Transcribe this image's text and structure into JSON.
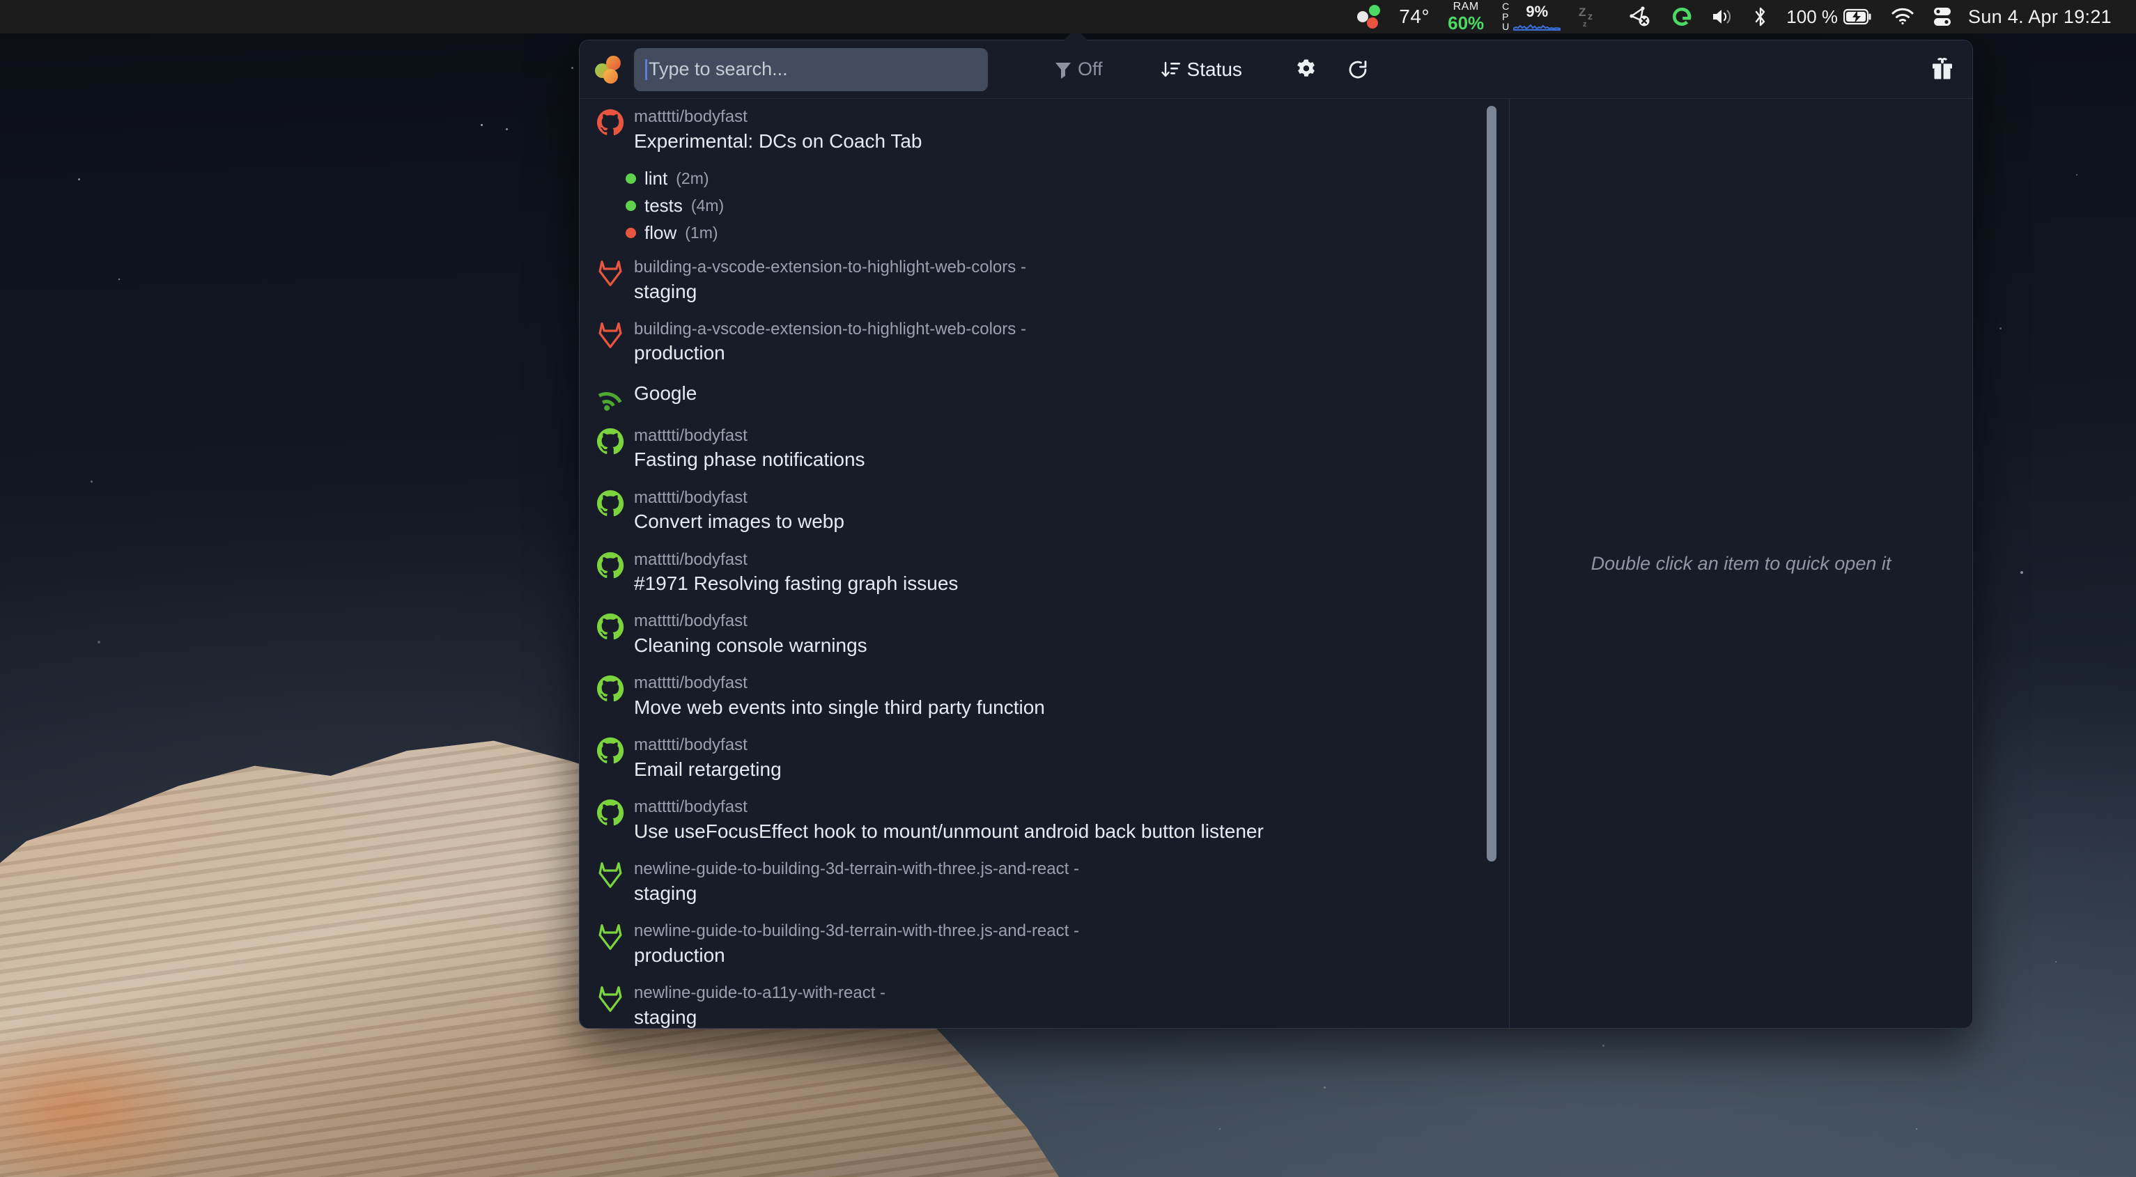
{
  "menubar": {
    "app_dots_icon": "three-dots-icon",
    "temperature": "74°",
    "ram_label": "RAM",
    "ram_value": "60%",
    "cpu_label": "CPU",
    "cpu_value": "9%",
    "caffeine_icon": "zzz-icon",
    "airplay_muted_icon": "airplay-muted-icon",
    "grammarly_icon": "grammarly-g-icon",
    "volume_icon": "volume-icon",
    "bluetooth_icon": "bluetooth-icon",
    "battery_percent": "100 %",
    "battery_icon": "battery-charging-icon",
    "wifi_icon": "wifi-icon",
    "control_center_icon": "control-center-icon",
    "datetime": "Sun 4. Apr  19:21",
    "colors": {
      "green": "#4cd964",
      "red": "#e8543f",
      "white": "#e8e8e8",
      "cpu_graph": "#3a6fd8"
    }
  },
  "window": {
    "logo_icon": "three-circles-logo",
    "search": {
      "value": "",
      "placeholder": "Type to search..."
    },
    "toolbar": {
      "filter_icon": "filter-icon",
      "filter_label": "Off",
      "sort_icon": "sort-descending-icon",
      "sort_label": "Status",
      "settings_icon": "gear-icon",
      "refresh_icon": "refresh-icon",
      "gift_icon": "gift-icon"
    },
    "right_panel": {
      "hint": "Double click an item to quick open it"
    },
    "colors": {
      "window_bg": "#171c28",
      "search_bg": "#434b5e",
      "github_green": "#7bd43e",
      "github_red": "#e8563f",
      "gitlab_red": "#e8563f",
      "gitlab_green": "#7bd43e",
      "rss_green": "#4fa832",
      "scrollbar": "#7c8596"
    },
    "items": [
      {
        "source": "github",
        "icon": "github-icon",
        "icon_color": "#e8563f",
        "repo": "matttti/bodyfast",
        "title": "Experimental: DCs on Coach Tab",
        "checks": [
          {
            "name": "lint",
            "duration": "(2m)",
            "status_color": "#5ed24b"
          },
          {
            "name": "tests",
            "duration": "(4m)",
            "status_color": "#5ed24b"
          },
          {
            "name": "flow",
            "duration": "(1m)",
            "status_color": "#e8563f"
          }
        ]
      },
      {
        "source": "gitlab",
        "icon": "gitlab-icon",
        "icon_color": "#e8563f",
        "repo": "building-a-vscode-extension-to-highlight-web-colors",
        "sep": "-",
        "title": "staging",
        "checks": []
      },
      {
        "source": "gitlab",
        "icon": "gitlab-icon",
        "icon_color": "#e8563f",
        "repo": "building-a-vscode-extension-to-highlight-web-colors",
        "sep": "-",
        "title": "production",
        "checks": []
      },
      {
        "source": "rss",
        "icon": "rss-icon",
        "icon_color": "#4fa832",
        "repo": "",
        "title": "Google",
        "checks": []
      },
      {
        "source": "github",
        "icon": "github-icon",
        "icon_color": "#7bd43e",
        "repo": "matttti/bodyfast",
        "title": "Fasting phase notifications",
        "checks": []
      },
      {
        "source": "github",
        "icon": "github-icon",
        "icon_color": "#7bd43e",
        "repo": "matttti/bodyfast",
        "title": "Convert images to webp",
        "checks": []
      },
      {
        "source": "github",
        "icon": "github-icon",
        "icon_color": "#7bd43e",
        "repo": "matttti/bodyfast",
        "title": "#1971 Resolving fasting graph issues",
        "checks": []
      },
      {
        "source": "github",
        "icon": "github-icon",
        "icon_color": "#7bd43e",
        "repo": "matttti/bodyfast",
        "title": "Cleaning console warnings",
        "checks": []
      },
      {
        "source": "github",
        "icon": "github-icon",
        "icon_color": "#7bd43e",
        "repo": "matttti/bodyfast",
        "title": "Move web events into single third party function",
        "checks": []
      },
      {
        "source": "github",
        "icon": "github-icon",
        "icon_color": "#7bd43e",
        "repo": "matttti/bodyfast",
        "title": "Email retargeting",
        "checks": []
      },
      {
        "source": "github",
        "icon": "github-icon",
        "icon_color": "#7bd43e",
        "repo": "matttti/bodyfast",
        "title": "Use useFocusEffect hook to mount/unmount android back button listener",
        "checks": []
      },
      {
        "source": "gitlab",
        "icon": "gitlab-icon",
        "icon_color": "#7bd43e",
        "repo": "newline-guide-to-building-3d-terrain-with-three.js-and-react",
        "sep": "-",
        "title": "staging",
        "checks": []
      },
      {
        "source": "gitlab",
        "icon": "gitlab-icon",
        "icon_color": "#7bd43e",
        "repo": "newline-guide-to-building-3d-terrain-with-three.js-and-react",
        "sep": "-",
        "title": "production",
        "checks": []
      },
      {
        "source": "gitlab",
        "icon": "gitlab-icon",
        "icon_color": "#7bd43e",
        "repo": "newline-guide-to-a11y-with-react",
        "sep": "-",
        "title": "staging",
        "checks": []
      },
      {
        "source": "gitlab",
        "icon": "gitlab-icon",
        "icon_color": "#7bd43e",
        "repo": "newline-guide-to-a11y-with-react",
        "sep": "",
        "title": "",
        "checks": []
      }
    ]
  }
}
